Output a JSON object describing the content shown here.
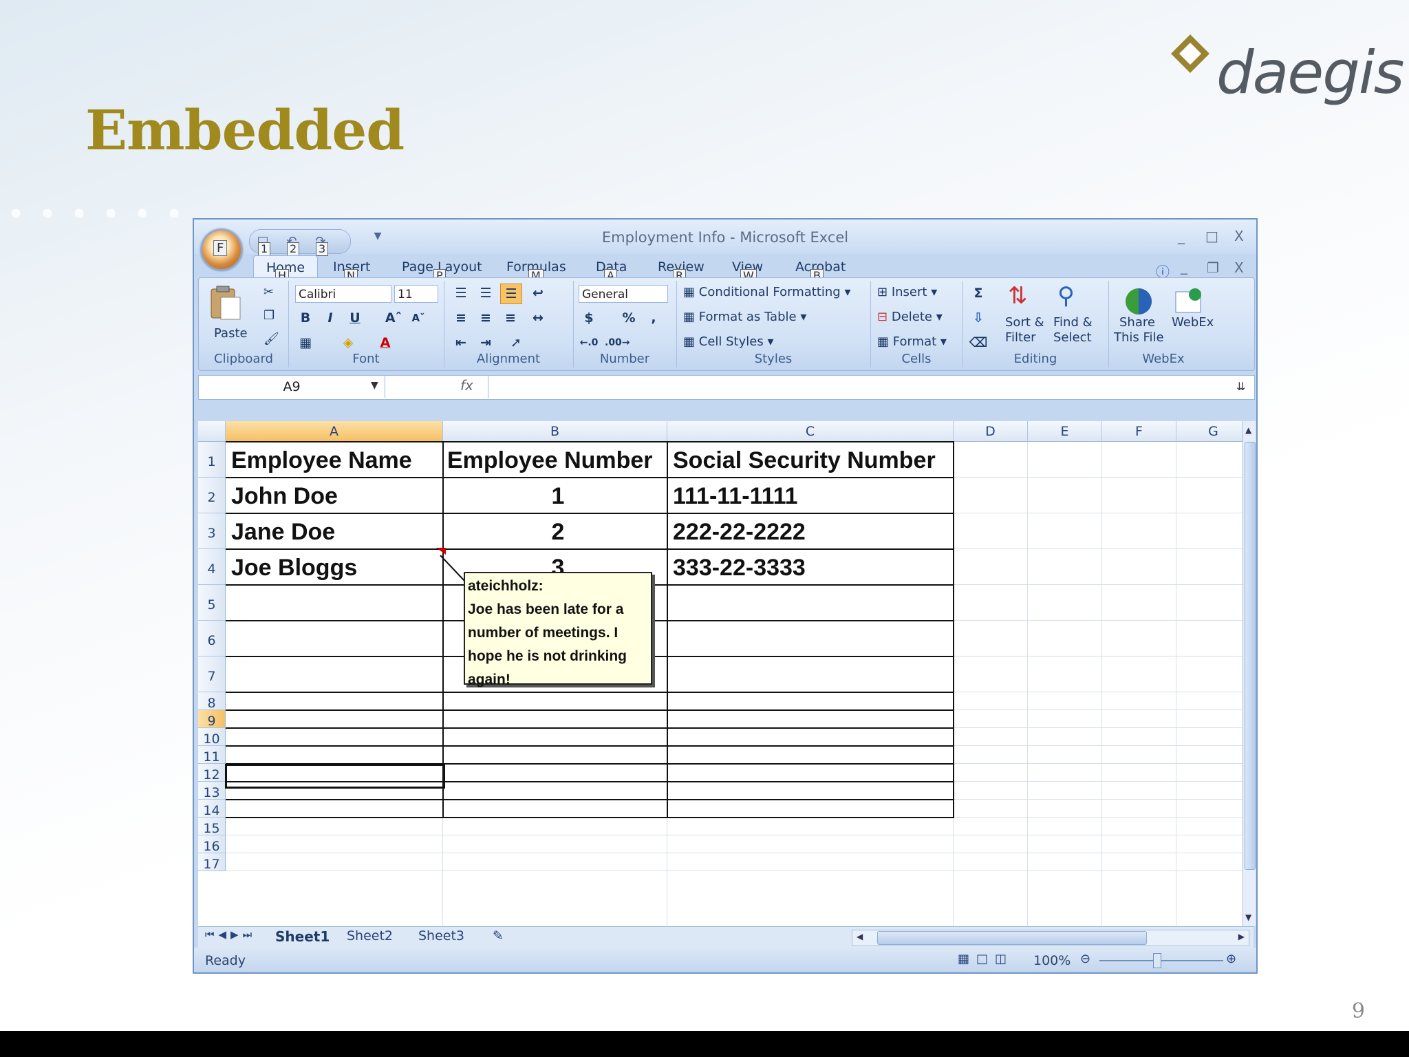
{
  "slide": {
    "title": "Embedded",
    "logo_text": "daegis",
    "page_number": "9"
  },
  "window": {
    "title": "Employment Info - Microsoft Excel",
    "office_button_keytip": "F",
    "qat_keytips": [
      "1",
      "2",
      "3"
    ],
    "controls": [
      "_",
      "□",
      "X"
    ]
  },
  "ribbon": {
    "tabs": [
      {
        "label": "Home",
        "keytip": "H"
      },
      {
        "label": "Insert",
        "keytip": "N"
      },
      {
        "label": "Page Layout",
        "keytip": "P"
      },
      {
        "label": "Formulas",
        "keytip": "M"
      },
      {
        "label": "Data",
        "keytip": "A"
      },
      {
        "label": "Review",
        "keytip": "R"
      },
      {
        "label": "View",
        "keytip": "W"
      },
      {
        "label": "Acrobat",
        "keytip": "B"
      }
    ],
    "clipboard": {
      "label": "Clipboard",
      "paste": "Paste"
    },
    "font": {
      "label": "Font",
      "family": "Calibri",
      "size": "11",
      "bold": "B",
      "italic": "I",
      "underline": "U"
    },
    "alignment": {
      "label": "Alignment"
    },
    "number": {
      "label": "Number",
      "format": "General",
      "currency": "$",
      "percent": "%",
      "comma": ","
    },
    "styles": {
      "label": "Styles",
      "conditional": "Conditional Formatting",
      "format_table": "Format as Table",
      "cell_styles": "Cell Styles"
    },
    "cells": {
      "label": "Cells",
      "insert": "Insert",
      "delete": "Delete",
      "format": "Format"
    },
    "editing": {
      "label": "Editing",
      "sort": "Sort &",
      "filter": "Filter",
      "find": "Find &",
      "select": "Select",
      "sigma": "Σ"
    },
    "webex": {
      "label": "WebEx",
      "share1": "Share",
      "share2": "This File",
      "webex": "WebEx"
    }
  },
  "formula_bar": {
    "name_box": "A9",
    "fx": "fx",
    "value": ""
  },
  "sheet": {
    "columns": [
      "A",
      "B",
      "C",
      "D",
      "E",
      "F",
      "G"
    ],
    "rows": [
      "1",
      "2",
      "3",
      "4",
      "5",
      "6",
      "7",
      "8",
      "9",
      "10",
      "11",
      "12",
      "13",
      "14",
      "15",
      "16",
      "17"
    ],
    "data": [
      [
        "Employee Name",
        "Employee Number",
        "Social Security Number"
      ],
      [
        "John Doe",
        "1",
        "111-11-1111"
      ],
      [
        "Jane Doe",
        "2",
        "222-22-2222"
      ],
      [
        "Joe Bloggs",
        "3",
        "333-22-3333"
      ]
    ],
    "comment": {
      "author": "ateichholz:",
      "text": "Joe has been late for a number of meetings.  I hope he is not drinking again!"
    }
  },
  "sheet_tabs": [
    "Sheet1",
    "Sheet2",
    "Sheet3"
  ],
  "status": {
    "ready": "Ready",
    "zoom": "100%"
  }
}
